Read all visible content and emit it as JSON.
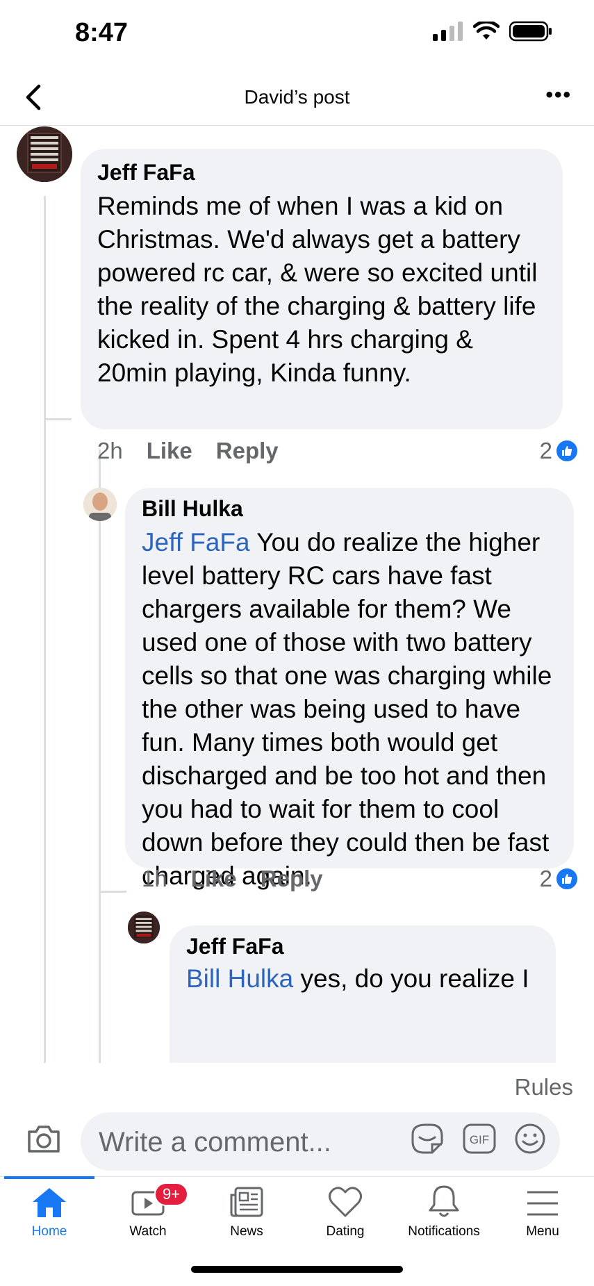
{
  "status_bar": {
    "time": "8:47"
  },
  "nav": {
    "title": "David’s post"
  },
  "comments": [
    {
      "author": "Jeff FaFa",
      "text": "Reminds me of when I was a kid on Christmas. We'd always get a battery powered rc car, & were so excited until the reality of the charging & battery life kicked in. Spent 4 hrs charging & 20min playing,  Kinda funny.",
      "age": "2h",
      "like_label": "Like",
      "reply_label": "Reply",
      "reaction_count": "2"
    },
    {
      "author": "Bill Hulka",
      "mention": "Jeff FaFa",
      "text": " You do realize the higher level battery RC cars have fast chargers available for them?  We used one of those with two battery cells so that one was charging while the other was being used to have fun.  Many times both would get discharged and be too hot and then you had to wait for them to cool down before they could then be fast charged again.",
      "age": "1h",
      "like_label": "Like",
      "reply_label": "Reply",
      "reaction_count": "2"
    },
    {
      "author": "Jeff FaFa",
      "mention": "Bill Hulka",
      "text": " yes, do you realize I"
    }
  ],
  "rules_label": "Rules",
  "composer": {
    "placeholder": "Write a comment..."
  },
  "tabs": [
    {
      "label": "Home",
      "icon": "home-icon"
    },
    {
      "label": "Watch",
      "icon": "watch-icon",
      "badge": "9+"
    },
    {
      "label": "News",
      "icon": "news-icon"
    },
    {
      "label": "Dating",
      "icon": "dating-icon"
    },
    {
      "label": "Notifications",
      "icon": "bell-icon"
    },
    {
      "label": "Menu",
      "icon": "menu-icon"
    }
  ],
  "colors": {
    "accent": "#1877f2",
    "mention": "#2d65bd",
    "bubble": "#f0f2f5",
    "badge": "#e41e3f"
  }
}
